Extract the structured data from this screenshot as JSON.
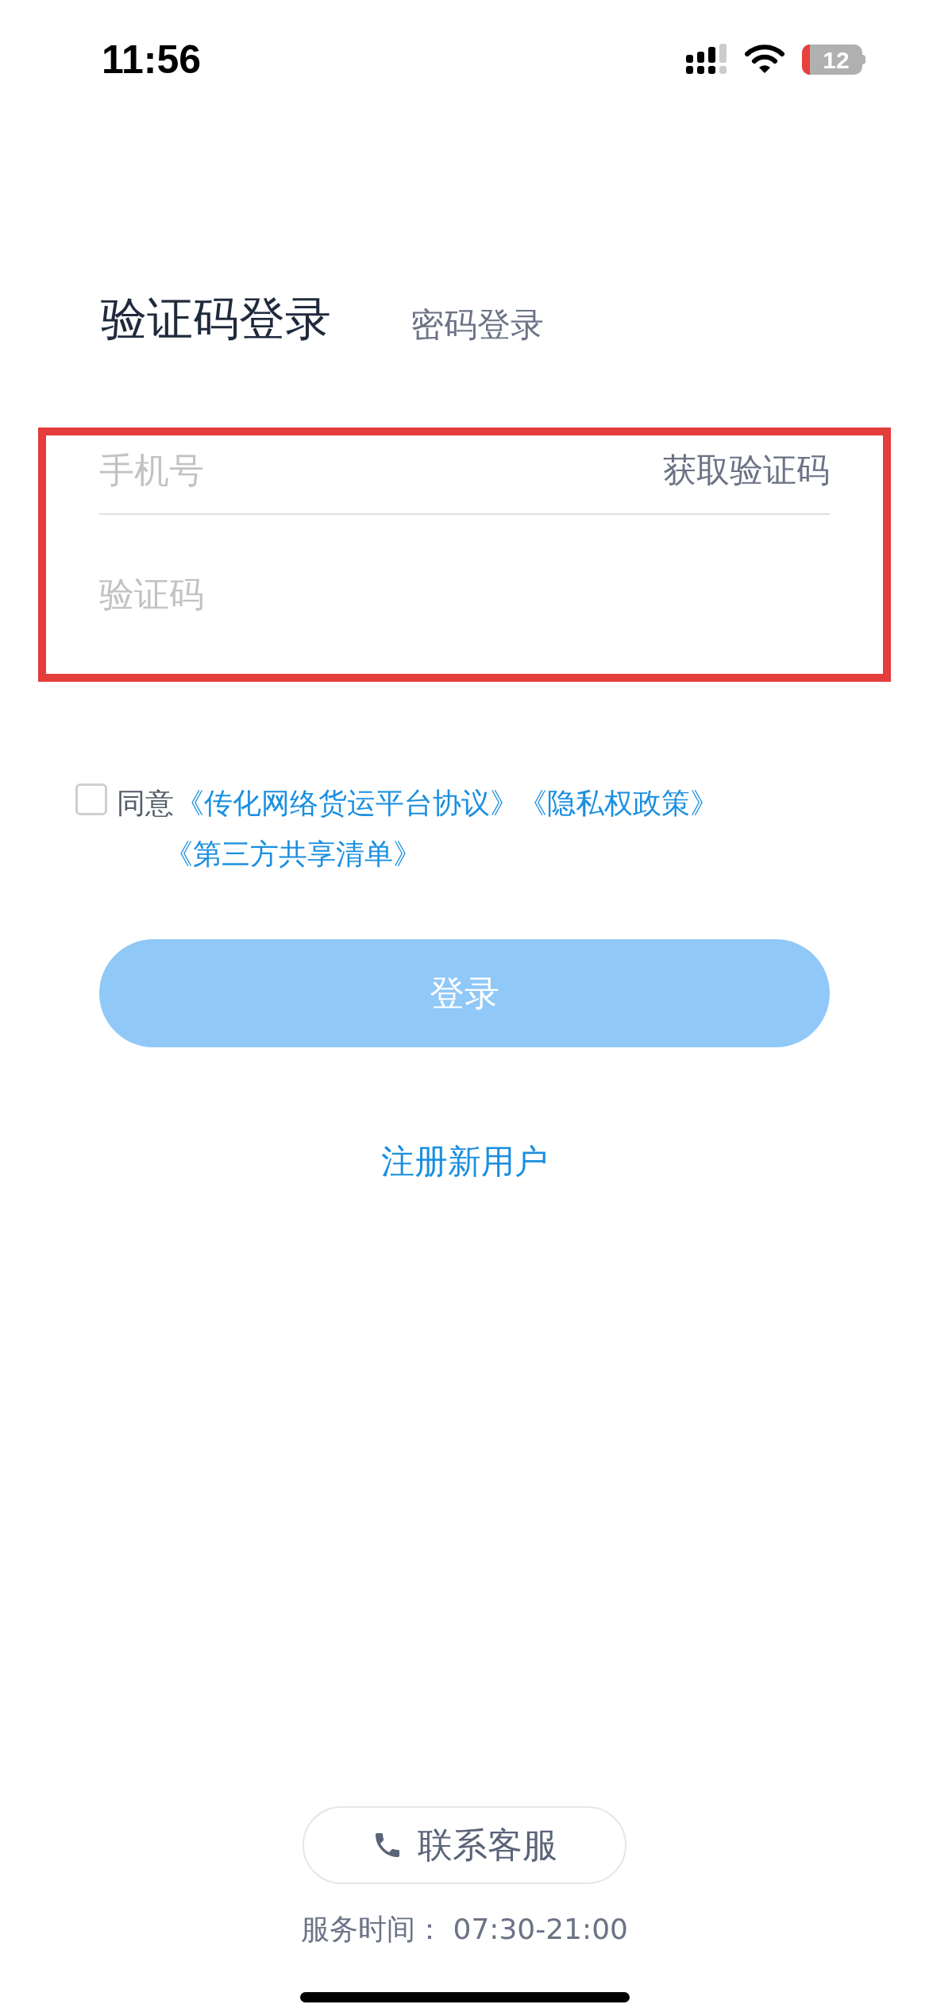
{
  "status_bar": {
    "time": "11:56",
    "battery": "12"
  },
  "tabs": [
    {
      "label": "验证码登录",
      "selected": true
    },
    {
      "label": "密码登录",
      "selected": false
    }
  ],
  "form": {
    "highlighted": true,
    "phone": {
      "placeholder": "手机号",
      "action": "获取验证码"
    },
    "code": {
      "placeholder": "验证码"
    }
  },
  "agreement": {
    "checked": false,
    "prefix": "同意",
    "links": [
      "《传化网络货运平台协议》",
      "《隐私权政策》",
      "《第三方共享清单》"
    ]
  },
  "login_button": {
    "label": "登录",
    "disabled": true
  },
  "register_link": "注册新用户",
  "contact_button": "联系客服",
  "service_hours": "服务时间： 07:30-21:00"
}
